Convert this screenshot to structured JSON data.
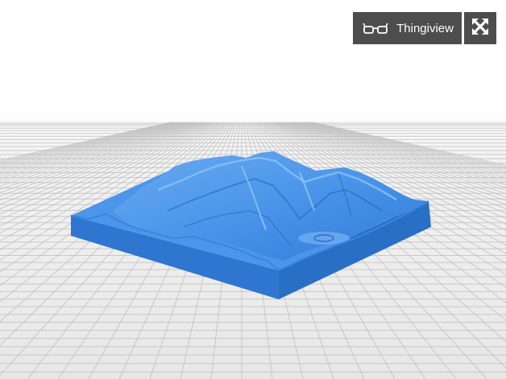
{
  "viewer": {
    "model_color": "#3d8ee6",
    "grid_color": "#bdbdbd",
    "background_color": "#ebebeb"
  },
  "toolbar": {
    "thingiview_label": "Thingiview",
    "thingiview_icon": "glasses-icon",
    "fullscreen_icon": "expand-arrows-icon",
    "button_color": "#4d4d4d"
  }
}
